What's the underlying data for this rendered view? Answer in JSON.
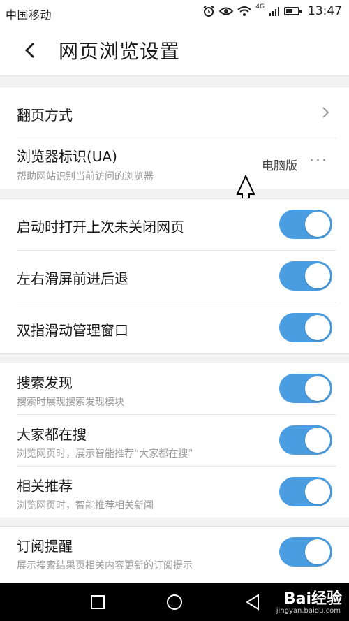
{
  "status": {
    "carrier": "中国移动",
    "time": "13:47",
    "network": "4G"
  },
  "header": {
    "title": "网页浏览设置"
  },
  "settings": {
    "page_turn": {
      "label": "翻页方式"
    },
    "ua": {
      "label": "浏览器标识(UA)",
      "desc": "帮助网站识别当前访问的浏览器",
      "value": "电脑版",
      "more": "···"
    },
    "restore": {
      "label": "启动时打开上次未关闭网页",
      "on": true
    },
    "swipe": {
      "label": "左右滑屏前进后退",
      "on": true
    },
    "two_finger": {
      "label": "双指滑动管理窗口",
      "on": true
    },
    "search_discover": {
      "label": "搜索发现",
      "desc": "搜索时展现搜索发现模块",
      "on": true
    },
    "everyone_search": {
      "label": "大家都在搜",
      "desc": "浏览网页时，展示智能推荐“大家都在搜”",
      "on": true
    },
    "related": {
      "label": "相关推荐",
      "desc": "浏览网页时，智能推荐相关新闻",
      "on": true
    },
    "subscribe": {
      "label": "订阅提醒",
      "desc": "展示搜索结果页相关内容更新的订阅提示",
      "on": true
    }
  },
  "watermark": {
    "text": "Bai经验",
    "url": "jingyan.baidu.com"
  },
  "colors": {
    "toggle_on": "#4a9de0",
    "background": "#f2f2f2"
  }
}
